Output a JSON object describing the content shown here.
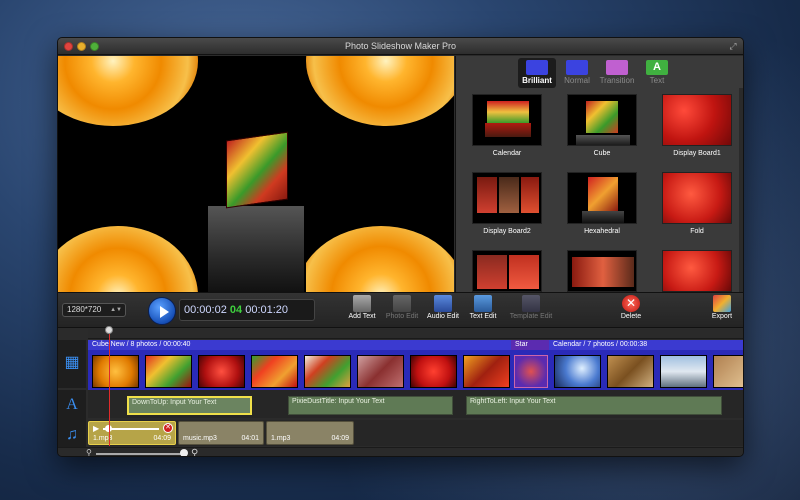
{
  "app": {
    "title": "Photo Slideshow Maker Pro"
  },
  "effect_tabs": [
    {
      "label": "Brilliant",
      "color": "#3b43e0",
      "active": true
    },
    {
      "label": "Normal",
      "color": "#3b43e0",
      "active": false
    },
    {
      "label": "Transition",
      "color": "#c060d0",
      "active": false
    },
    {
      "label": "Text",
      "color": "#40b040",
      "active": false
    }
  ],
  "effects": [
    {
      "label": "Calendar"
    },
    {
      "label": "Cube"
    },
    {
      "label": "Display Board1"
    },
    {
      "label": "Display Board2"
    },
    {
      "label": "Hexahedral"
    },
    {
      "label": "Fold"
    },
    {
      "label": ""
    },
    {
      "label": ""
    },
    {
      "label": ""
    }
  ],
  "toolbar": {
    "resolution": "1280*720",
    "current_time": "00:00:02",
    "frame": "04",
    "total_time": "00:01:20",
    "add_text": "Add Text",
    "photo_edit": "Photo Edit",
    "audio_edit": "Audio Edit",
    "text_edit": "Text Edit",
    "template_edit": "Template Edit",
    "delete": "Delete",
    "export": "Export"
  },
  "timeline": {
    "segment1": "Cube New / 8 photos / 00:00:40",
    "transition": "Star",
    "segment2": "Calendar / 7 photos / 00:00:38",
    "text_clips": [
      "DownToUp: Input Your Text",
      "PixieDustTitle: Input Your Text",
      "RightToLeft: Input Your Text"
    ],
    "music_clips": [
      {
        "name": "1.mp3",
        "duration": "04:09"
      },
      {
        "name": "music.mp3",
        "duration": "04:01"
      },
      {
        "name": "1.mp3",
        "duration": "04:09"
      }
    ]
  },
  "icons": {
    "film_track": "film-icon",
    "text_track": "text-icon",
    "music_track": "music-icon"
  }
}
